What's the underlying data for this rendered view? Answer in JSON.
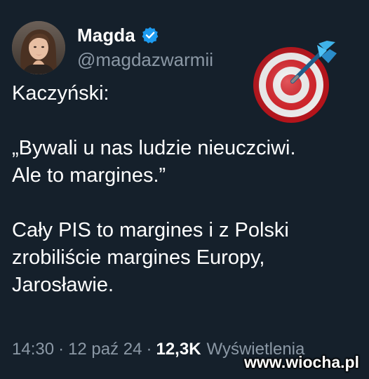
{
  "author": {
    "name": "Magda",
    "handle": "@magdazwarmii",
    "verified": true
  },
  "emoji": "target-dart-icon",
  "tweet": {
    "lines": [
      "Kaczyński:",
      "",
      "„Bywali u nas ludzie nieuczciwi.",
      "Ale to margines.”",
      "",
      "Cały PIS to margines i z Polski",
      "zrobiliście margines Europy,",
      "Jarosławie."
    ]
  },
  "meta": {
    "time": "14:30",
    "separator": "·",
    "date": "12 paź 24",
    "views_count": "12,3K",
    "views_label": "Wyświetlenia"
  },
  "watermark": "www.wiocha.pl",
  "colors": {
    "background": "#15202b",
    "text": "#ffffff",
    "secondary_text": "#8b98a5",
    "verified_badge": "#1d9bf0"
  }
}
